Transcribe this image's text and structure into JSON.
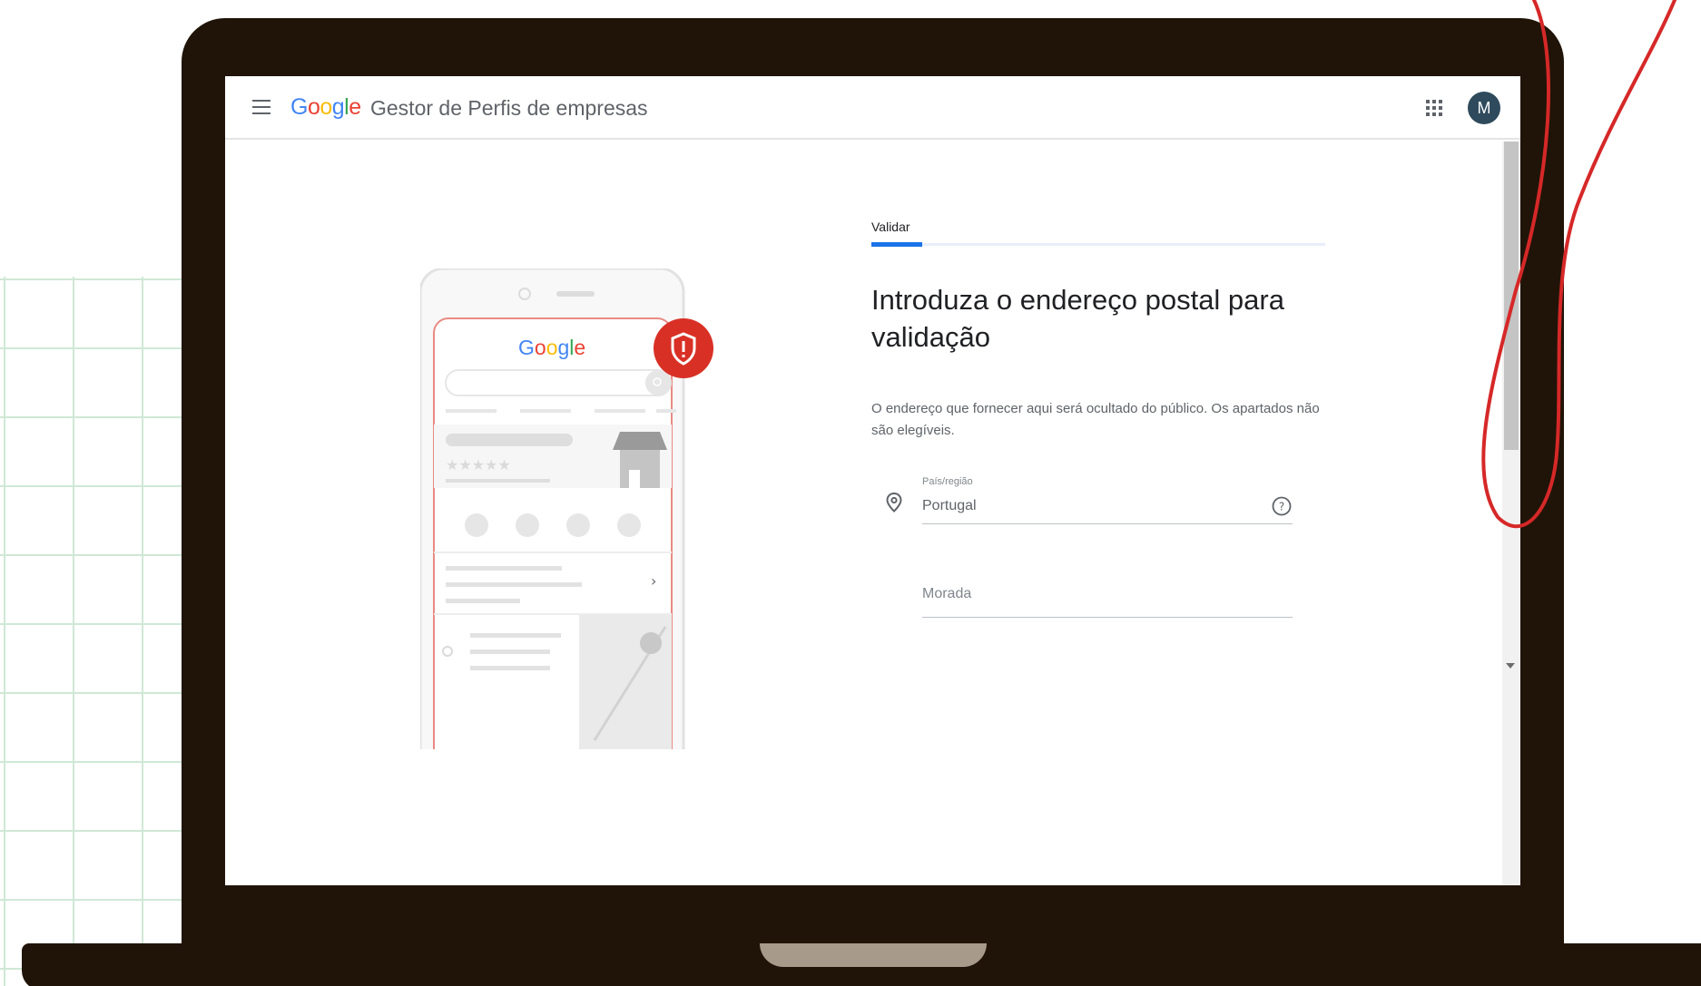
{
  "header": {
    "logo_text": "Google",
    "product_name": "Gestor de Perfis de empresas",
    "avatar_initial": "M",
    "menu_icon": "hamburger-menu-icon",
    "apps_icon": "apps-grid-icon"
  },
  "illustration": {
    "logo_text": "Google",
    "stars": "★★★★★",
    "badge_icon": "shield-alert-icon"
  },
  "form": {
    "tab_label": "Validar",
    "heading": "Introduza o endereço postal para validação",
    "description": "O endereço que fornecer aqui será ocultado do público. Os apartados não são elegíveis.",
    "country_label": "País/região",
    "country_value": "Portugal",
    "address_placeholder": "Morada"
  },
  "colors": {
    "accent": "#1a73e8",
    "badge_red": "#d93025",
    "laptop": "#201408",
    "annotation_red": "#d62828"
  }
}
